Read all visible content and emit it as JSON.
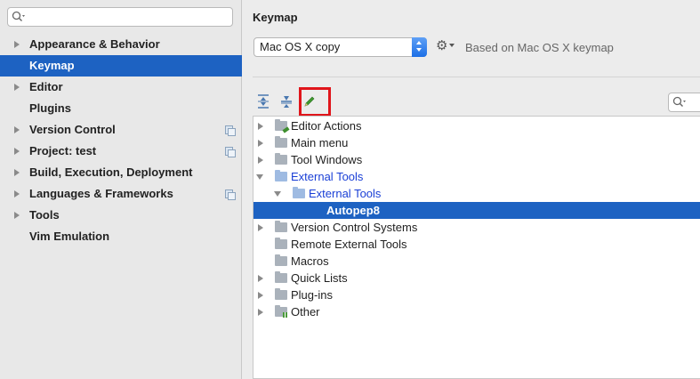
{
  "sidebar": {
    "search": {
      "placeholder": ""
    },
    "items": [
      {
        "label": "Appearance & Behavior"
      },
      {
        "label": "Keymap"
      },
      {
        "label": "Editor"
      },
      {
        "label": "Plugins"
      },
      {
        "label": "Version Control"
      },
      {
        "label": "Project: test"
      },
      {
        "label": "Build, Execution, Deployment"
      },
      {
        "label": "Languages & Frameworks"
      },
      {
        "label": "Tools"
      },
      {
        "label": "Vim Emulation"
      }
    ],
    "selected_label": "Keymap"
  },
  "main": {
    "title": "Keymap",
    "keymap_select": {
      "value": "Mac OS X copy"
    },
    "based_on": "Based on Mac OS X keymap",
    "toolbar": {
      "expand_all_icon": "expand-all-icon",
      "collapse_all_icon": "collapse-all-icon",
      "edit_icon": "pencil-icon",
      "highlight_color": "#e0151b"
    },
    "tree": [
      {
        "label": "Editor Actions"
      },
      {
        "label": "Main menu"
      },
      {
        "label": "Tool Windows"
      },
      {
        "label": "External Tools"
      },
      {
        "label": "External Tools"
      },
      {
        "label": "Autopep8"
      },
      {
        "label": "Version Control Systems"
      },
      {
        "label": "Remote External Tools"
      },
      {
        "label": "Macros"
      },
      {
        "label": "Quick Lists"
      },
      {
        "label": "Plug-ins"
      },
      {
        "label": "Other"
      }
    ]
  },
  "colors": {
    "selection": "#1d62c2",
    "link_blue": "#1a3fd6"
  }
}
